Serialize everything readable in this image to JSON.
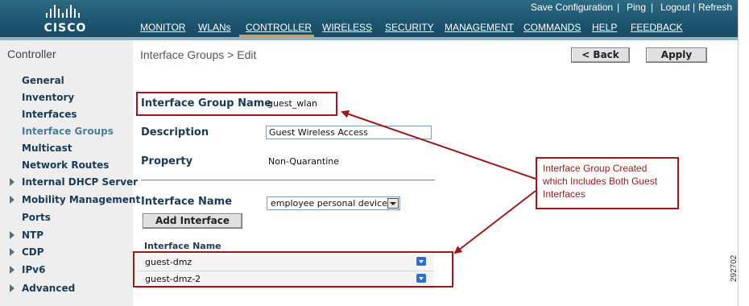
{
  "brand": {
    "logo_text": "CISCO"
  },
  "utility_links": [
    "Save Configuration",
    "Ping",
    "Logout",
    "Refresh"
  ],
  "main_nav": {
    "items": [
      "MONITOR",
      "WLANs",
      "CONTROLLER",
      "WIRELESS",
      "SECURITY",
      "MANAGEMENT",
      "COMMANDS",
      "HELP",
      "FEEDBACK"
    ],
    "active": "CONTROLLER"
  },
  "sidebar": {
    "title": "Controller",
    "items": [
      {
        "label": "General"
      },
      {
        "label": "Inventory"
      },
      {
        "label": "Interfaces"
      },
      {
        "label": "Interface Groups",
        "current": true
      },
      {
        "label": "Multicast"
      },
      {
        "label": "Network Routes"
      },
      {
        "label": "Internal DHCP Server",
        "expandable": true
      },
      {
        "label": "Mobility Management",
        "expandable": true
      },
      {
        "label": "Ports"
      },
      {
        "label": "NTP",
        "expandable": true
      },
      {
        "label": "CDP",
        "expandable": true
      },
      {
        "label": "IPv6",
        "expandable": true
      },
      {
        "label": "Advanced",
        "expandable": true
      }
    ]
  },
  "page": {
    "breadcrumb": "Interface Groups > Edit",
    "back_button": "< Back",
    "apply_button": "Apply"
  },
  "form": {
    "group_name_label": "Interface Group Name",
    "group_name_value": "guest_wlan",
    "description_label": "Description",
    "description_value": "Guest Wireless Access",
    "property_label": "Property",
    "property_value": "Non-Quarantine",
    "interface_name_label": "Interface Name",
    "interface_name_selected": "employee personal devices",
    "add_interface_button": "Add Interface"
  },
  "interfaces_table": {
    "header": "Interface Name",
    "rows": [
      "guest-dmz",
      "guest-dmz-2"
    ]
  },
  "annotation": {
    "callout_text": "Interface Group Created which Includes Both Guest Interfaces",
    "color": "#a01818"
  },
  "figure_number": "292702",
  "colors": {
    "topbar": "#1e5672",
    "active_tab_underline": "#e49a2c",
    "label_text": "#1a3a56",
    "annotation": "#a01818"
  }
}
